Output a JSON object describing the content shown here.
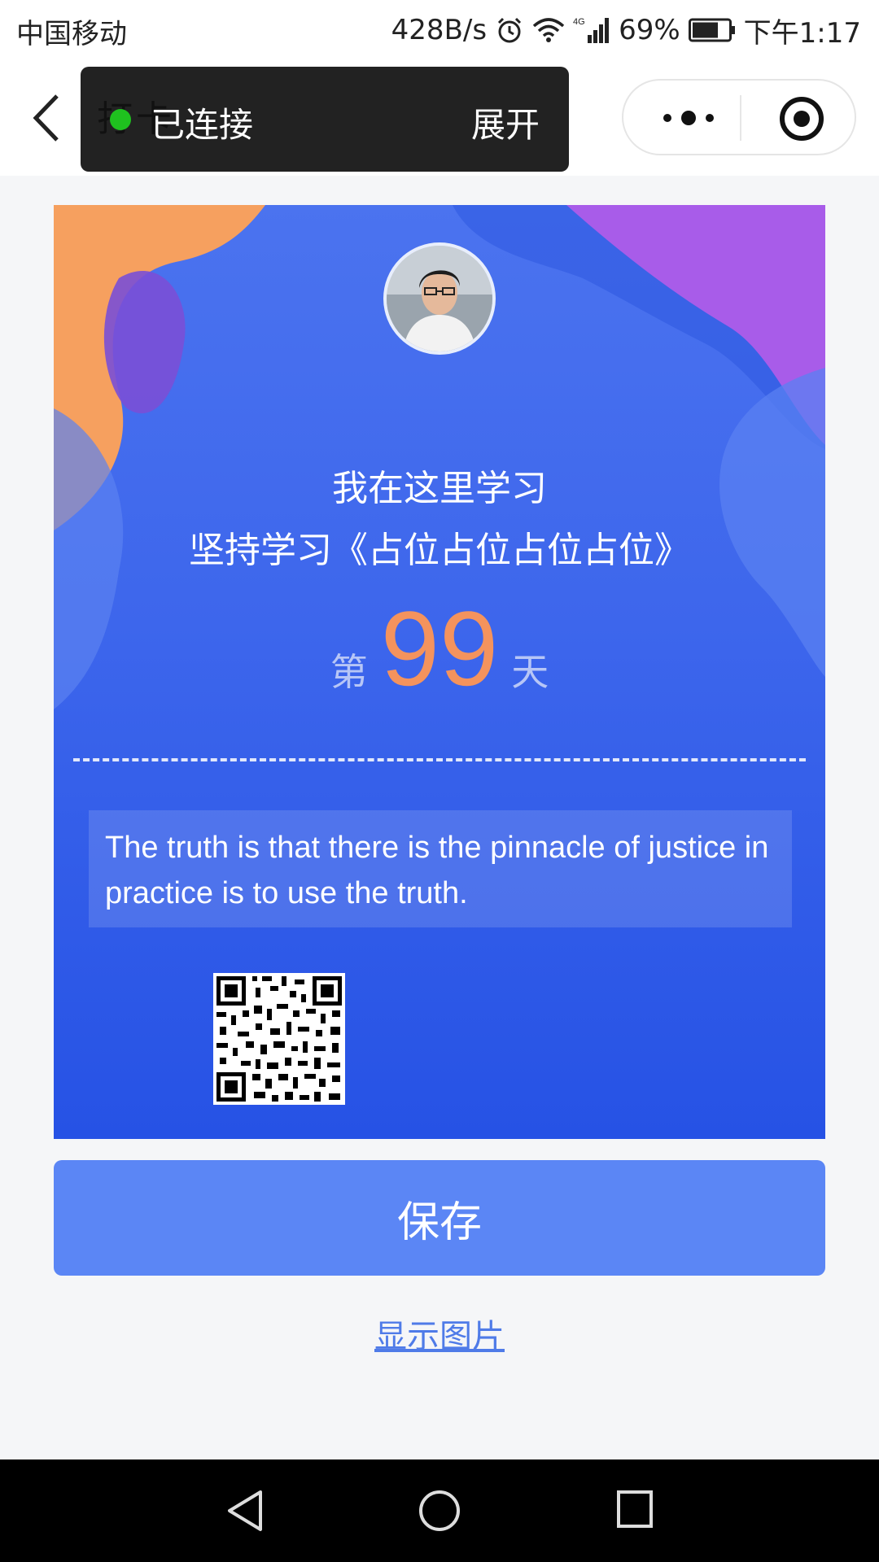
{
  "status_bar": {
    "carrier": "中国移动",
    "speed": "428B/s",
    "network": "4G",
    "battery": "69%",
    "time": "下午1:17"
  },
  "nav": {
    "toast_hidden_text": "打卡",
    "connection_status": "已连接",
    "expand_label": "展开"
  },
  "poster": {
    "line1": "我在这里学习",
    "line2": "坚持学习《占位占位占位占位》",
    "day_prefix": "第",
    "day_count": "99",
    "day_suffix": "天",
    "quote": "The truth is that there is the pinnacle of justice in practice is to use the truth.",
    "colors": {
      "accent_orange": "#f4935d",
      "poster_blue": "#3d66ec"
    }
  },
  "actions": {
    "save_label": "保存",
    "show_image_label": "显示图片"
  }
}
